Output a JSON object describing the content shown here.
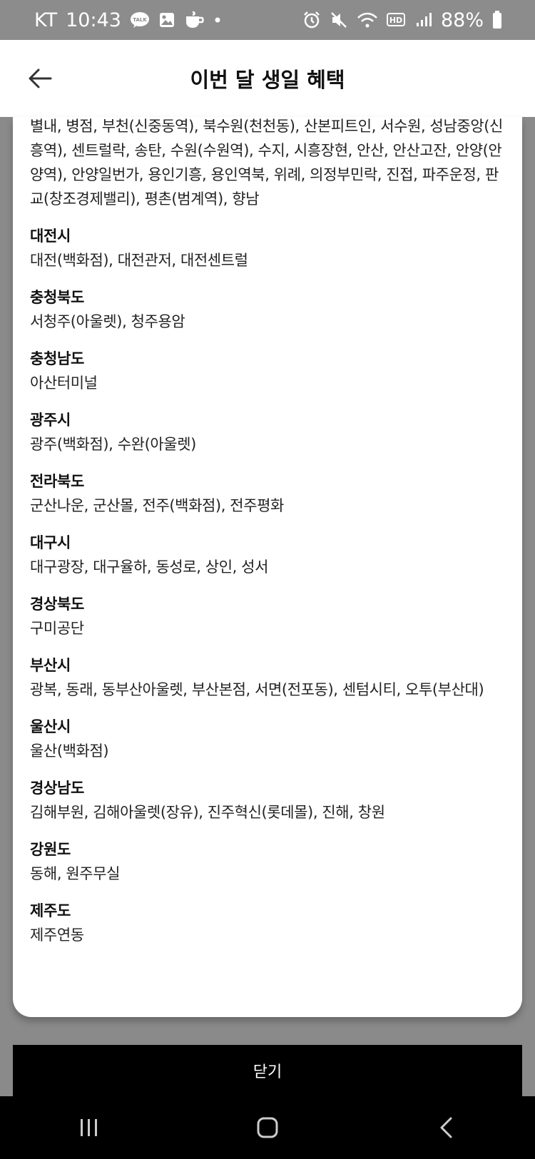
{
  "status_bar": {
    "carrier": "KT",
    "time": "10:43",
    "talk_badge": "TALK",
    "battery_percent": "88%",
    "battery_level": 0.88
  },
  "header": {
    "title": "이번 달 생일 혜택"
  },
  "content": {
    "intro_text": "별내, 병점, 부천(신중동역), 북수원(천천동), 산본피트인, 서수원, 성남중앙(신흥역), 센트럴락, 송탄, 수원(수원역), 수지, 시흥장현, 안산, 안산고잔, 안양(안양역), 안양일번가, 용인기흥, 용인역북, 위례, 의정부민락, 진접, 파주운정, 판교(창조경제밸리), 평촌(범계역), 향남",
    "regions": [
      {
        "name": "대전시",
        "stores": "대전(백화점), 대전관저, 대전센트럴"
      },
      {
        "name": "충청북도",
        "stores": "서청주(아울렛), 청주용암"
      },
      {
        "name": "충청남도",
        "stores": "아산터미널"
      },
      {
        "name": "광주시",
        "stores": "광주(백화점), 수완(아울렛)"
      },
      {
        "name": "전라북도",
        "stores": "군산나운, 군산몰, 전주(백화점), 전주평화"
      },
      {
        "name": "대구시",
        "stores": "대구광장, 대구율하, 동성로, 상인, 성서"
      },
      {
        "name": "경상북도",
        "stores": "구미공단"
      },
      {
        "name": "부산시",
        "stores": "광복, 동래, 동부산아울렛, 부산본점, 서면(전포동), 센텀시티, 오투(부산대)"
      },
      {
        "name": "울산시",
        "stores": "울산(백화점)"
      },
      {
        "name": "경상남도",
        "stores": "김해부원, 김해아울렛(장유), 진주혁신(롯데몰), 진해, 창원"
      },
      {
        "name": "강원도",
        "stores": "동해, 원주무실"
      },
      {
        "name": "제주도",
        "stores": "제주연동"
      }
    ]
  },
  "footer": {
    "close_label": "닫기"
  },
  "nav_icons": [
    "recent-apps-icon",
    "home-icon",
    "back-nav-icon"
  ]
}
